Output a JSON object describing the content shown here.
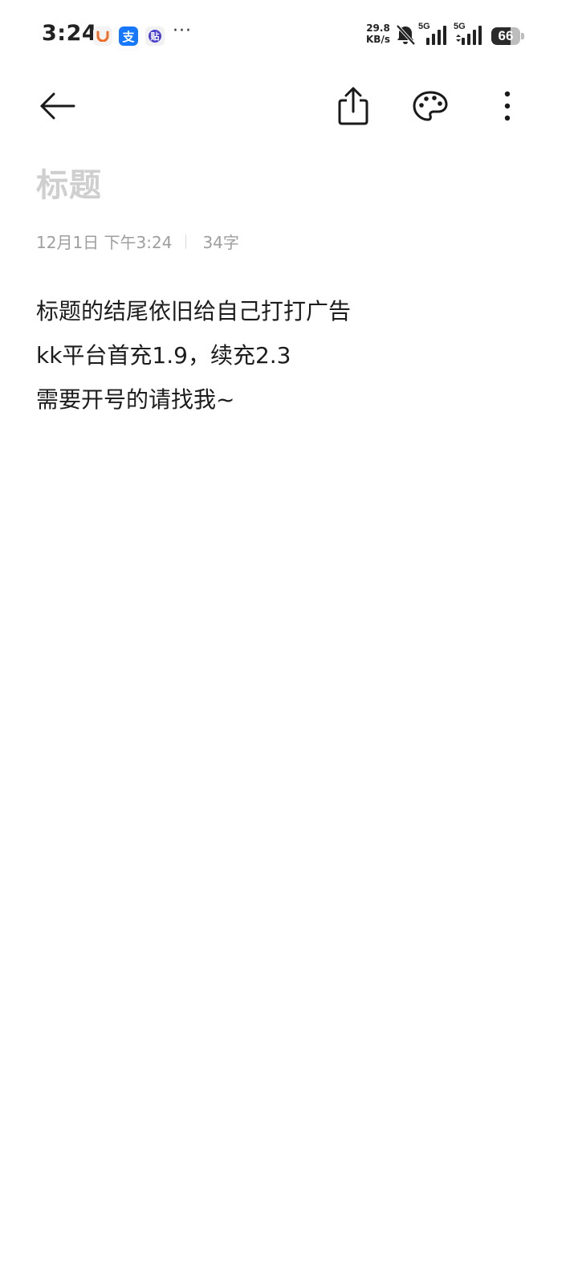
{
  "status_bar": {
    "time": "3:24",
    "app_icons": [
      "didi-icon",
      "alipay-icon",
      "tieba-icon"
    ],
    "alipay_glyph": "支",
    "tieba_glyph": "贴",
    "more": "···",
    "net_speed_value": "29.8",
    "net_speed_unit": "KB/s",
    "sim1_label": "5G",
    "sim2_label": "5G",
    "battery_level": "66",
    "battery_fraction": 0.66
  },
  "toolbar": {
    "back_icon": "arrow-left-icon",
    "share_icon": "share-icon",
    "theme_icon": "palette-icon",
    "more_icon": "more-vertical-icon"
  },
  "note": {
    "title_placeholder": "标题",
    "date": "12月1日 下午3:24",
    "word_count": "34字",
    "lines": [
      "标题的结尾依旧给自己打打广告",
      "kk平台首充1.9，续充2.3",
      "需要开号的请找我~"
    ]
  },
  "colors": {
    "background": "#ffffff",
    "text": "#1c1c1c",
    "placeholder": "#cfcfcf",
    "meta": "#9e9e9e",
    "alipay_blue": "#1677ff",
    "didi_orange": "#f26b22",
    "tieba_purple": "#4b3fd1"
  }
}
